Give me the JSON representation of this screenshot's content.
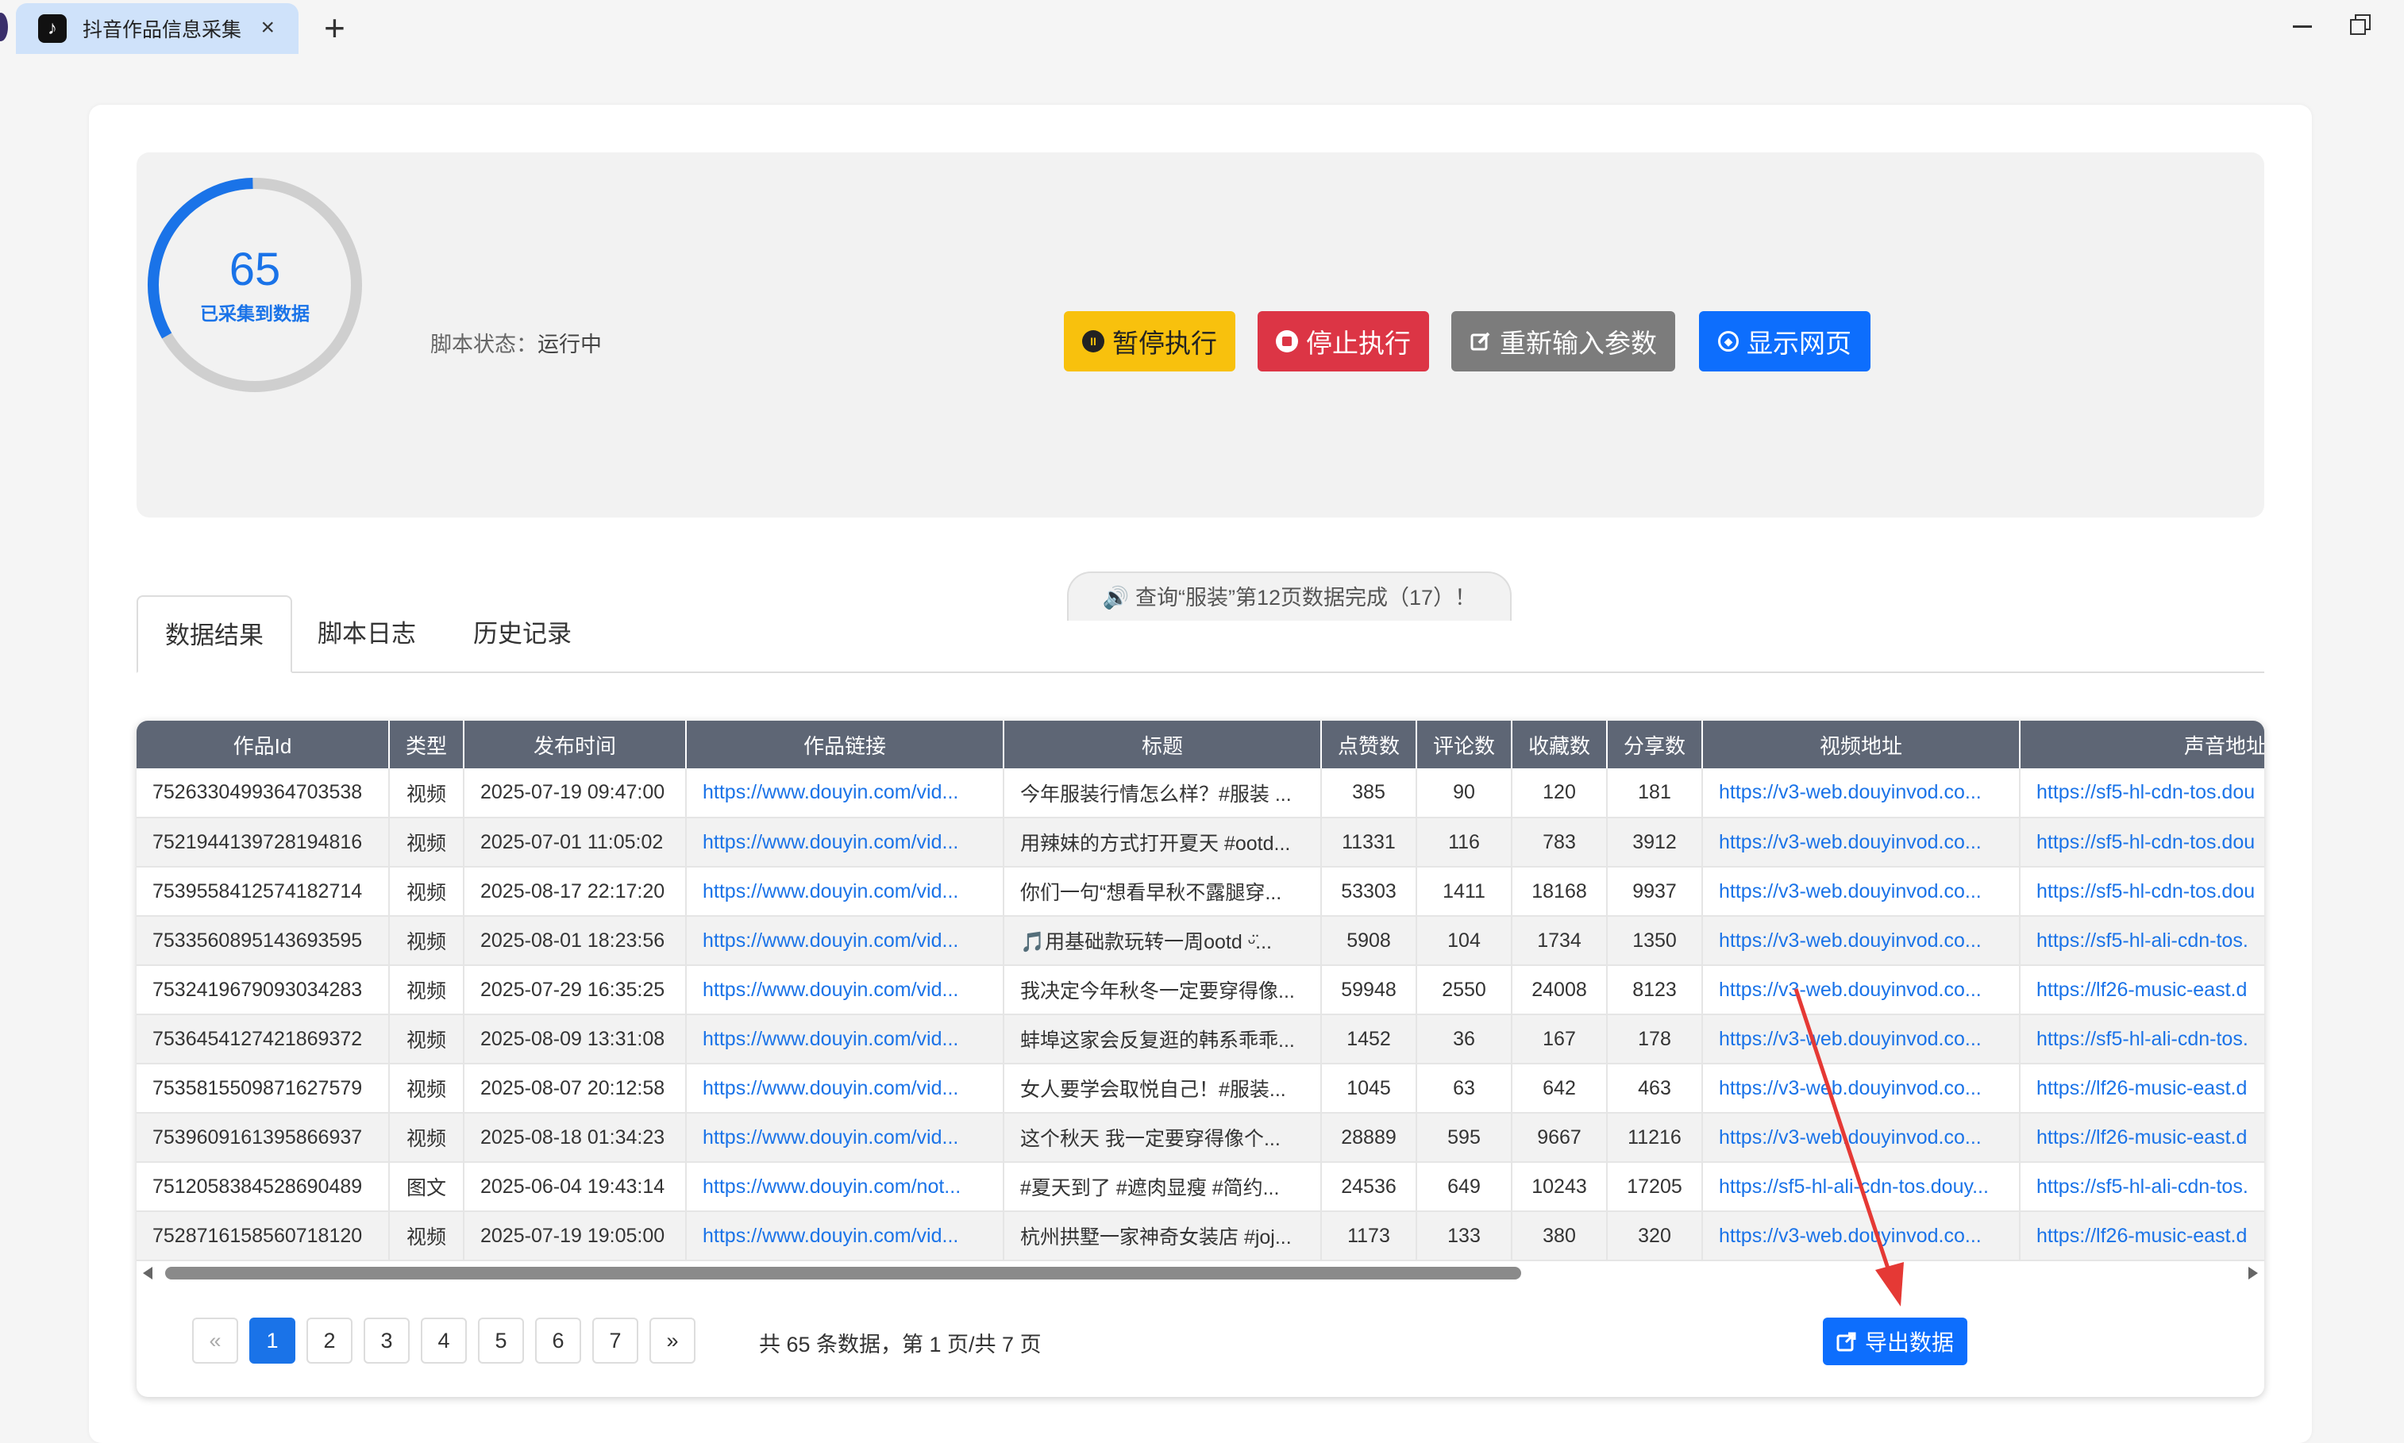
{
  "window": {
    "tab_title": "抖音作品信息采集",
    "tab_logo": "♪",
    "close": "×",
    "add": "+"
  },
  "stats": {
    "count": "65",
    "count_label": "已采集到数据",
    "progress": 0.33,
    "ring_color": "#1a73e8",
    "track_color": "#cfcfcf"
  },
  "status": {
    "label": "脚本状态：",
    "value": "运行中"
  },
  "buttons": {
    "pause": "暂停执行",
    "stop": "停止执行",
    "reenter": "重新输入参数",
    "show_web": "显示网页",
    "export": "导出数据"
  },
  "notice": "🔊 查询“服装”第12页数据完成（17）！",
  "tabs": [
    {
      "label": "数据结果",
      "active": true
    },
    {
      "label": "脚本日志",
      "active": false
    },
    {
      "label": "历史记录",
      "active": false
    }
  ],
  "table": {
    "headers": [
      "作品Id",
      "类型",
      "发布时间",
      "作品链接",
      "标题",
      "点赞数",
      "评论数",
      "收藏数",
      "分享数",
      "视频地址",
      "声音地址"
    ],
    "rows": [
      [
        "7526330499364703538",
        "视频",
        "2025-07-19 09:47:00",
        "https://www.douyin.com/vid...",
        "今年服装行情怎么样？#服装 ...",
        "385",
        "90",
        "120",
        "181",
        "https://v3-web.douyinvod.co...",
        "https://sf5-hl-cdn-tos.dou"
      ],
      [
        "7521944139728194816",
        "视频",
        "2025-07-01 11:05:02",
        "https://www.douyin.com/vid...",
        "用辣妹的方式打开夏天 #ootd...",
        "11331",
        "116",
        "783",
        "3912",
        "https://v3-web.douyinvod.co...",
        "https://sf5-hl-cdn-tos.dou"
      ],
      [
        "7539558412574182714",
        "视频",
        "2025-08-17 22:17:20",
        "https://www.douyin.com/vid...",
        "你们一句“想看早秋不露腿穿...",
        "53303",
        "1411",
        "18168",
        "9937",
        "https://v3-web.douyinvod.co...",
        "https://sf5-hl-cdn-tos.dou"
      ],
      [
        "7533560895143693595",
        "视频",
        "2025-08-01 18:23:56",
        "https://www.douyin.com/vid...",
        "🎵用基础款玩转一周ootd ᵕ̈...",
        "5908",
        "104",
        "1734",
        "1350",
        "https://v3-web.douyinvod.co...",
        "https://sf5-hl-ali-cdn-tos."
      ],
      [
        "7532419679093034283",
        "视频",
        "2025-07-29 16:35:25",
        "https://www.douyin.com/vid...",
        "我决定今年秋冬一定要穿得像...",
        "59948",
        "2550",
        "24008",
        "8123",
        "https://v3-web.douyinvod.co...",
        "https://lf26-music-east.d"
      ],
      [
        "7536454127421869372",
        "视频",
        "2025-08-09 13:31:08",
        "https://www.douyin.com/vid...",
        "蚌埠这家会反复逛的韩系乖乖...",
        "1452",
        "36",
        "167",
        "178",
        "https://v3-web.douyinvod.co...",
        "https://sf5-hl-ali-cdn-tos."
      ],
      [
        "7535815509871627579",
        "视频",
        "2025-08-07 20:12:58",
        "https://www.douyin.com/vid...",
        "女人要学会取悦自己！#服装...",
        "1045",
        "63",
        "642",
        "463",
        "https://v3-web.douyinvod.co...",
        "https://lf26-music-east.d"
      ],
      [
        "7539609161395866937",
        "视频",
        "2025-08-18 01:34:23",
        "https://www.douyin.com/vid...",
        "这个秋天 我一定要穿得像个...",
        "28889",
        "595",
        "9667",
        "11216",
        "https://v3-web.douyinvod.co...",
        "https://lf26-music-east.d"
      ],
      [
        "7512058384528690489",
        "图文",
        "2025-06-04 19:43:14",
        "https://www.douyin.com/not...",
        "#夏天到了 #遮肉显瘦 #简约...",
        "24536",
        "649",
        "10243",
        "17205",
        "https://sf5-hl-ali-cdn-tos.douy...",
        "https://sf5-hl-ali-cdn-tos."
      ],
      [
        "7528716158560718120",
        "视频",
        "2025-07-19 19:05:00",
        "https://www.douyin.com/vid...",
        "杭州拱墅一家神奇女装店 #joj...",
        "1173",
        "133",
        "380",
        "320",
        "https://v3-web.douyinvod.co...",
        "https://lf26-music-east.d"
      ]
    ]
  },
  "pagination": {
    "prev": "«",
    "next": "»",
    "pages": [
      "1",
      "2",
      "3",
      "4",
      "5",
      "6",
      "7"
    ],
    "current": "1",
    "summary": "共 65 条数据，第 1 页/共 7 页"
  },
  "annotation_color": "#e53935"
}
